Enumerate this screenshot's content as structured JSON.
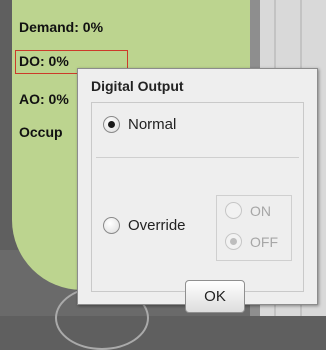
{
  "background": {
    "labels": {
      "demand": "Demand: 0%",
      "do": "DO: 0%",
      "ao": "AO: 0%",
      "occupancy": "Occup"
    }
  },
  "dialog": {
    "title": "Digital Output",
    "mode_options": [
      {
        "label": "Normal",
        "selected": true
      },
      {
        "label": "Override",
        "selected": false
      }
    ],
    "override_options": [
      {
        "label": "ON",
        "selected": false,
        "enabled": false
      },
      {
        "label": "OFF",
        "selected": true,
        "enabled": false
      }
    ],
    "ok_label": "OK"
  }
}
